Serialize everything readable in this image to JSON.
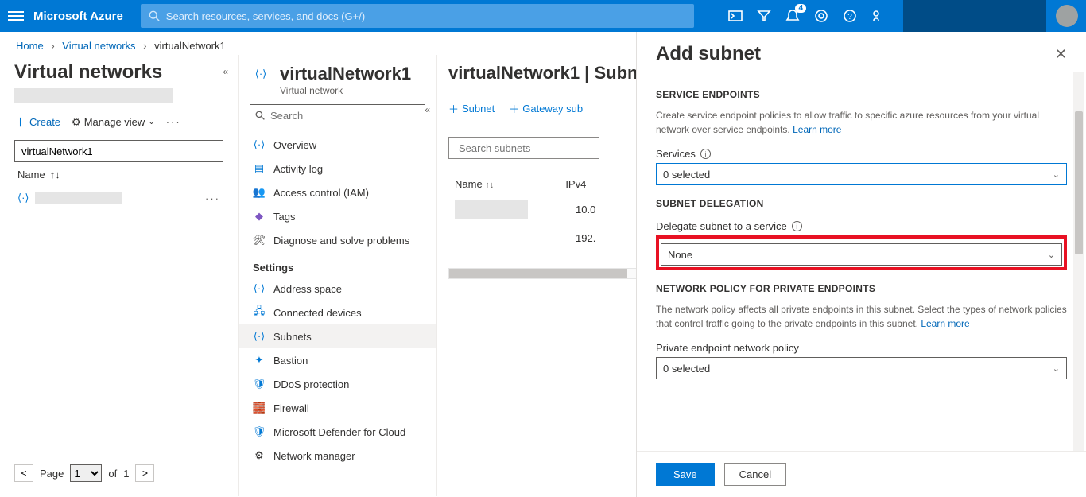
{
  "topbar": {
    "brand": "Microsoft Azure",
    "searchPlaceholder": "Search resources, services, and docs (G+/)",
    "notificationCount": "4"
  },
  "breadcrumb": {
    "home": "Home",
    "l1": "Virtual networks",
    "l2": "virtualNetwork1"
  },
  "col1": {
    "title": "Virtual networks",
    "create": "Create",
    "manageView": "Manage view",
    "filterValue": "virtualNetwork1",
    "nameHeader": "Name",
    "pager": {
      "pageWord": "Page",
      "current": "1",
      "ofWord": "of",
      "total": "1"
    }
  },
  "col2": {
    "titlePrefix": "virtualNetwork1",
    "titleSuffix": "Subnets",
    "subtitle": "Virtual network",
    "searchPlaceholder": "Search",
    "settingsLabel": "Settings",
    "nav": {
      "overview": "Overview",
      "activity": "Activity log",
      "iam": "Access control (IAM)",
      "tags": "Tags",
      "diagnose": "Diagnose and solve problems",
      "addressSpace": "Address space",
      "connectedDevices": "Connected devices",
      "subnets": "Subnets",
      "bastion": "Bastion",
      "ddos": "DDoS protection",
      "firewall": "Firewall",
      "defender": "Microsoft Defender for Cloud",
      "networkManager": "Network manager"
    }
  },
  "col3": {
    "addSubnet": "Subnet",
    "addGateway": "Gateway sub",
    "searchPlaceholder": "Search subnets",
    "headers": {
      "name": "Name",
      "ipv4": "IPv4"
    },
    "rows": [
      {
        "ip": "10.0"
      },
      {
        "ip": "192."
      }
    ]
  },
  "flyout": {
    "title": "Add subnet",
    "serviceEndpoints": {
      "header": "SERVICE ENDPOINTS",
      "desc": "Create service endpoint policies to allow traffic to specific azure resources from your virtual network over service endpoints.",
      "learnMore": "Learn more",
      "servicesLabel": "Services",
      "servicesValue": "0 selected"
    },
    "delegation": {
      "header": "SUBNET DELEGATION",
      "label": "Delegate subnet to a service",
      "value": "None"
    },
    "networkPolicy": {
      "header": "NETWORK POLICY FOR PRIVATE ENDPOINTS",
      "desc": "The network policy affects all private endpoints in this subnet. Select the types of network policies that control traffic going to the private endpoints in this subnet.",
      "learnMore": "Learn more",
      "label": "Private endpoint network policy",
      "value": "0 selected"
    },
    "save": "Save",
    "cancel": "Cancel"
  }
}
